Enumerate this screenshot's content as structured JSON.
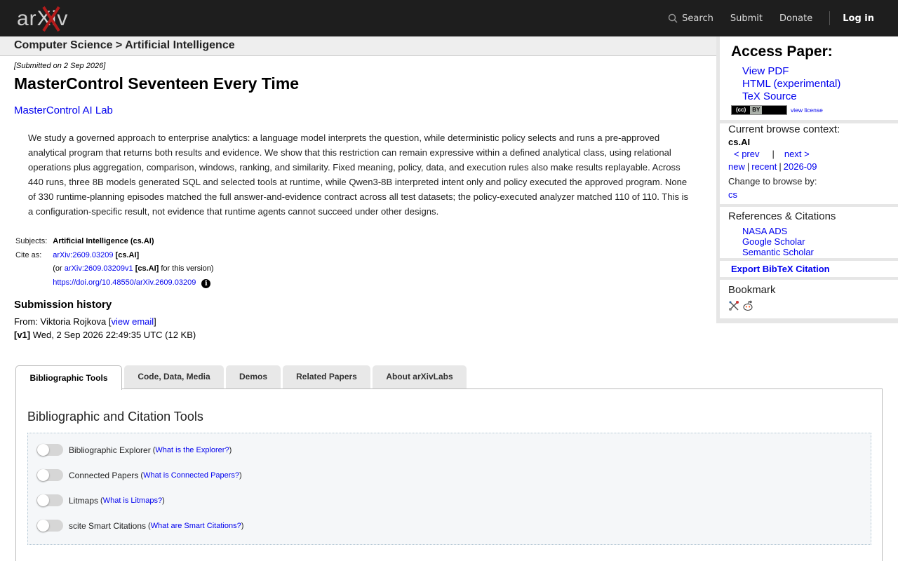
{
  "nav": {
    "logo_text": "arXiv",
    "search_label": "Search",
    "submit_label": "Submit",
    "donate_label": "Donate",
    "login_label": "Log in"
  },
  "breadcrumb": "Computer Science > Artificial Intelligence",
  "paper": {
    "dateline": "[Submitted on 2 Sep 2026]",
    "title": "MasterControl Seventeen Every Time",
    "authors": "MasterControl AI Lab",
    "abstract": "We study a governed approach to enterprise analytics: a language model interprets the question, while deterministic policy selects and runs a pre-approved analytical program that returns both results and evidence. We show that this restriction can remain expressive within a defined analytical class, using relational operations plus aggregation, comparison, windows, ranking, and similarity. Fixed meaning, policy, data, and execution rules also make results replayable. Across 440 runs, three 8B models generated SQL and selected tools at runtime, while Qwen3-8B interpreted intent only and policy executed the approved program. None of 330 runtime-planning episodes matched the full answer-and-evidence contract across all test datasets; the policy-executed analyzer matched 110 of 110. This is a configuration-specific result, not evidence that runtime agents cannot succeed under other designs."
  },
  "meta": {
    "subjects_label": "Subjects:",
    "subjects_value": "Artificial Intelligence (cs.AI)",
    "cite_label": "Cite as:",
    "cite_id": "arXiv:2609.03209",
    "cite_cat": "[cs.AI]",
    "or_prefix": "(or",
    "version_id": "arXiv:2609.03209v1",
    "version_cat": "[cs.AI]",
    "version_suffix": "for this version)",
    "doi": "https://doi.org/10.48550/arXiv.2609.03209",
    "info_glyph": "i"
  },
  "history": {
    "title": "Submission history",
    "from_prefix": "From: Viktoria Rojkova [",
    "view_email": "view email",
    "from_suffix": "]",
    "v1_label": "[v1]",
    "v1_text": "Wed, 2 Sep 2026 22:49:35 UTC (12 KB)"
  },
  "sidebar": {
    "access_title": "Access Paper:",
    "access_links": [
      "View PDF",
      "HTML (experimental)",
      "TeX Source"
    ],
    "cc_label": "(cc)",
    "cc_by": "BY",
    "view_license": "view license",
    "context_title": "Current browse context:",
    "context_cat": "cs.AI",
    "prev": "< prev",
    "sep": "|",
    "next": "next >",
    "new": "new",
    "recent": "recent",
    "month": "2026-09",
    "change_browse": "Change to browse by:",
    "cs": "cs",
    "refs_title": "References & Citations",
    "refs": [
      "NASA ADS",
      "Google Scholar",
      "Semantic Scholar"
    ],
    "bibtex": "Export BibTeX Citation",
    "bookmark_title": "Bookmark"
  },
  "tabs": [
    "Bibliographic Tools",
    "Code, Data, Media",
    "Demos",
    "Related Papers",
    "About arXivLabs"
  ],
  "panel": {
    "title": "Bibliographic and Citation Tools",
    "tools": [
      {
        "name": "Bibliographic Explorer",
        "link": "What is the Explorer?"
      },
      {
        "name": "Connected Papers",
        "link": "What is Connected Papers?"
      },
      {
        "name": "Litmaps",
        "link": "What is Litmaps?"
      },
      {
        "name": "scite Smart Citations",
        "link": "What are Smart Citations?"
      }
    ]
  },
  "colors": {
    "topbar": "#1e1e1e",
    "link": "#0000ee",
    "logo_red": "#b31b1b"
  }
}
